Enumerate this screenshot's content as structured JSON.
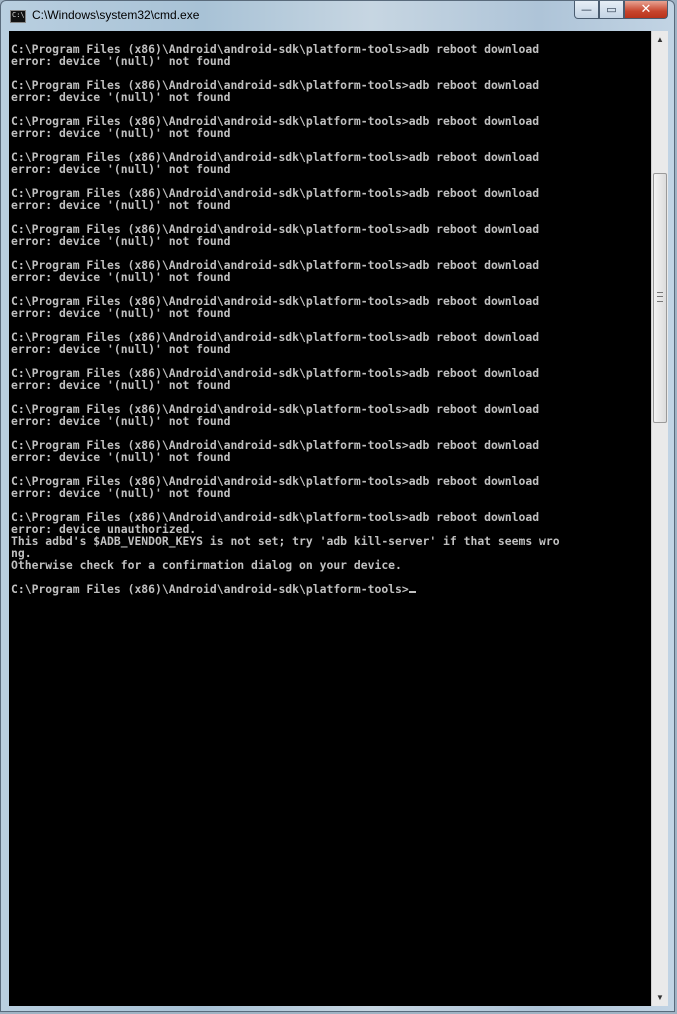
{
  "window": {
    "title": "C:\\Windows\\system32\\cmd.exe",
    "icon_label": "C:\\"
  },
  "controls": {
    "minimize_glyph": "—",
    "maximize_glyph": "▭",
    "close_glyph": "✕"
  },
  "console": {
    "text": "C:\\Program Files (x86)\\Android\\android-sdk\\platform-tools>adb reboot download\nerror: device '(null)' not found\n\nC:\\Program Files (x86)\\Android\\android-sdk\\platform-tools>adb reboot download\nerror: device '(null)' not found\n\nC:\\Program Files (x86)\\Android\\android-sdk\\platform-tools>adb reboot download\nerror: device '(null)' not found\n\nC:\\Program Files (x86)\\Android\\android-sdk\\platform-tools>adb reboot download\nerror: device '(null)' not found\n\nC:\\Program Files (x86)\\Android\\android-sdk\\platform-tools>adb reboot download\nerror: device '(null)' not found\n\nC:\\Program Files (x86)\\Android\\android-sdk\\platform-tools>adb reboot download\nerror: device '(null)' not found\n\nC:\\Program Files (x86)\\Android\\android-sdk\\platform-tools>adb reboot download\nerror: device '(null)' not found\n\nC:\\Program Files (x86)\\Android\\android-sdk\\platform-tools>adb reboot download\nerror: device '(null)' not found\n\nC:\\Program Files (x86)\\Android\\android-sdk\\platform-tools>adb reboot download\nerror: device '(null)' not found\n\nC:\\Program Files (x86)\\Android\\android-sdk\\platform-tools>adb reboot download\nerror: device '(null)' not found\n\nC:\\Program Files (x86)\\Android\\android-sdk\\platform-tools>adb reboot download\nerror: device '(null)' not found\n\nC:\\Program Files (x86)\\Android\\android-sdk\\platform-tools>adb reboot download\nerror: device '(null)' not found\n\nC:\\Program Files (x86)\\Android\\android-sdk\\platform-tools>adb reboot download\nerror: device '(null)' not found\n\nC:\\Program Files (x86)\\Android\\android-sdk\\platform-tools>adb reboot download\nerror: device unauthorized.\nThis adbd's $ADB_VENDOR_KEYS is not set; try 'adb kill-server' if that seems wro\nng.\nOtherwise check for a confirmation dialog on your device.\n\n",
    "prompt": "C:\\Program Files (x86)\\Android\\android-sdk\\platform-tools>"
  },
  "scrollbar": {
    "up_glyph": "▲",
    "down_glyph": "▼"
  }
}
